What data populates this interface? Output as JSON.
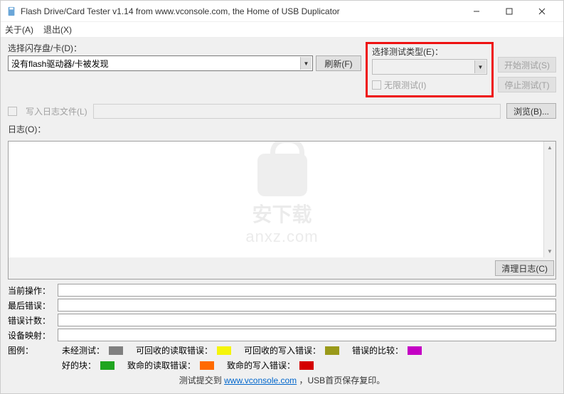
{
  "window": {
    "title": "Flash Drive/Card Tester v1.14 from www.vconsole.com, the Home of USB Duplicator"
  },
  "menu": {
    "about": "关于(A)",
    "exit": "退出(X)"
  },
  "select_drive": {
    "label": "选择闪存盘/卡(D)：",
    "value": "没有flash驱动器/卡被发现"
  },
  "refresh": "刷新(F)",
  "test_type": {
    "label": "选择测试类型(E)：",
    "infinite": "无限测试(I)"
  },
  "start": "开始测试(S)",
  "stop": "停止测试(T)",
  "log_file": {
    "label": "写入日志文件(L)"
  },
  "browse": "浏览(B)...",
  "log": {
    "label": "日志(O)：",
    "clear": "清理日志(C)"
  },
  "status": {
    "current": "当前操作：",
    "last_error": "最后错误：",
    "error_count": "错误计数：",
    "device_map": "设备映射："
  },
  "legend": {
    "label": "图例：",
    "untested": "未经测试：",
    "good": "好的块：",
    "recov_read": "可回收的读取错误：",
    "fatal_read": "致命的读取错误：",
    "recov_write": "可回收的写入错误：",
    "fatal_write": "致命的写入错误：",
    "compare": "错误的比较："
  },
  "footer": {
    "prefix": "测试提交到 ",
    "link": "www.vconsole.com",
    "suffix": "，USB首页保存复印。"
  },
  "watermark": {
    "cn": "安下载",
    "domain": "anxz.com"
  }
}
